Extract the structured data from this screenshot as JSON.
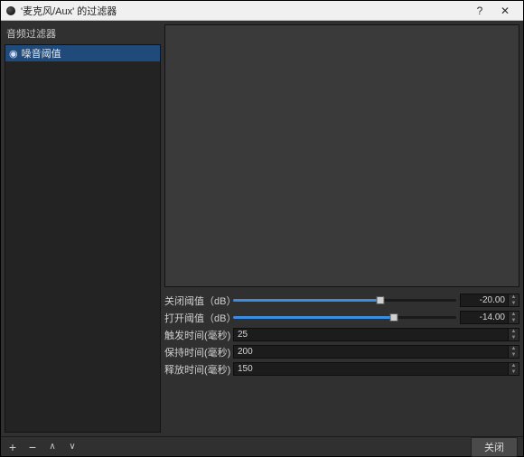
{
  "window": {
    "title": "'麦克风/Aux' 的过滤器"
  },
  "left_panel": {
    "header": "音频过滤器"
  },
  "filters": [
    {
      "name": "噪音阈值",
      "visible": true
    }
  ],
  "params": {
    "close_threshold": {
      "label": "关闭阈值（dB）",
      "value": "-20.00",
      "percent": 66
    },
    "open_threshold": {
      "label": "打开阈值（dB）",
      "value": "-14.00",
      "percent": 72
    },
    "attack": {
      "label": "触发时间(毫秒)",
      "value": "25"
    },
    "hold": {
      "label": "保持时间(毫秒)",
      "value": "200"
    },
    "release": {
      "label": "释放时间(毫秒)",
      "value": "150"
    }
  },
  "buttons": {
    "close": "关闭"
  }
}
